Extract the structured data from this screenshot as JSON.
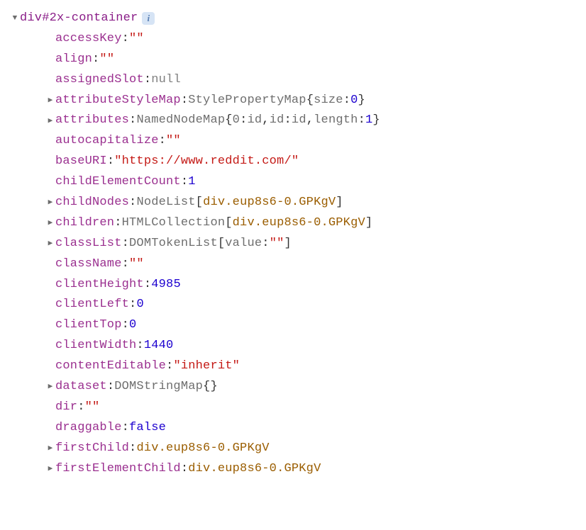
{
  "header": {
    "element_label": "div#2x-container",
    "info_badge": "i"
  },
  "props": [
    {
      "expandable": false,
      "key": "accessKey",
      "valueType": "str",
      "value": "\"\""
    },
    {
      "expandable": false,
      "key": "align",
      "valueType": "str",
      "value": "\"\""
    },
    {
      "expandable": false,
      "key": "assignedSlot",
      "valueType": "null",
      "value": "null"
    },
    {
      "expandable": true,
      "key": "attributeStyleMap",
      "valueType": "obj",
      "type": "StylePropertyMap",
      "preview": [
        {
          "k": "size",
          "vt": "num",
          "v": "0"
        }
      ]
    },
    {
      "expandable": true,
      "key": "attributes",
      "valueType": "obj",
      "type": "NamedNodeMap",
      "preview": [
        {
          "k": "0",
          "vt": "key",
          "v": "id"
        },
        {
          "k": "id",
          "vt": "key",
          "v": "id"
        },
        {
          "k": "length",
          "vt": "num",
          "v": "1"
        }
      ]
    },
    {
      "expandable": false,
      "key": "autocapitalize",
      "valueType": "str",
      "value": "\"\""
    },
    {
      "expandable": false,
      "key": "baseURI",
      "valueType": "str",
      "value": "\"https://www.reddit.com/\""
    },
    {
      "expandable": false,
      "key": "childElementCount",
      "valueType": "num",
      "value": "1"
    },
    {
      "expandable": true,
      "key": "childNodes",
      "valueType": "arr",
      "type": "NodeList",
      "items": [
        {
          "vt": "ref",
          "v": "div.eup8s6-0.GPKgV"
        }
      ]
    },
    {
      "expandable": true,
      "key": "children",
      "valueType": "arr",
      "type": "HTMLCollection",
      "items": [
        {
          "vt": "ref",
          "v": "div.eup8s6-0.GPKgV"
        }
      ]
    },
    {
      "expandable": true,
      "key": "classList",
      "valueType": "arr",
      "type": "DOMTokenList",
      "items": [
        {
          "k": "value",
          "vt": "str",
          "v": "\"\""
        }
      ]
    },
    {
      "expandable": false,
      "key": "className",
      "valueType": "str",
      "value": "\"\""
    },
    {
      "expandable": false,
      "key": "clientHeight",
      "valueType": "num",
      "value": "4985"
    },
    {
      "expandable": false,
      "key": "clientLeft",
      "valueType": "num",
      "value": "0"
    },
    {
      "expandable": false,
      "key": "clientTop",
      "valueType": "num",
      "value": "0"
    },
    {
      "expandable": false,
      "key": "clientWidth",
      "valueType": "num",
      "value": "1440"
    },
    {
      "expandable": false,
      "key": "contentEditable",
      "valueType": "str",
      "value": "\"inherit\""
    },
    {
      "expandable": true,
      "key": "dataset",
      "valueType": "obj",
      "type": "DOMStringMap",
      "preview": []
    },
    {
      "expandable": false,
      "key": "dir",
      "valueType": "str",
      "value": "\"\""
    },
    {
      "expandable": false,
      "key": "draggable",
      "valueType": "bool",
      "value": "false"
    },
    {
      "expandable": true,
      "key": "firstChild",
      "valueType": "ref",
      "value": "div.eup8s6-0.GPKgV"
    },
    {
      "expandable": true,
      "key": "firstElementChild",
      "valueType": "ref",
      "value": "div.eup8s6-0.GPKgV"
    }
  ]
}
